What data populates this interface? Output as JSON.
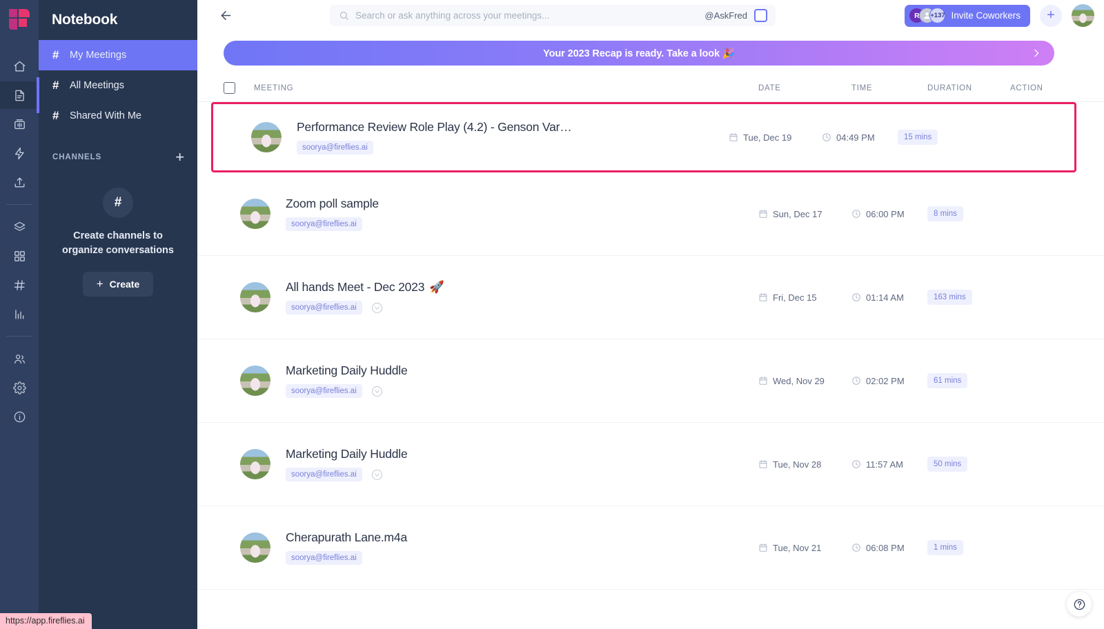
{
  "brand": {
    "logo_name": "fireflies-logo",
    "accent": "#6e75f5",
    "highlight": "#ea1e63"
  },
  "rail": {
    "items": [
      {
        "name": "home-icon",
        "label": "Home"
      },
      {
        "name": "notebook-icon",
        "label": "Notebook"
      },
      {
        "name": "inbox-icon",
        "label": "Inbox"
      },
      {
        "name": "automation-icon",
        "label": "Automations"
      },
      {
        "name": "upload-icon",
        "label": "Upload"
      },
      {
        "name": "layers-icon",
        "label": "Topic Tracker"
      },
      {
        "name": "apps-icon",
        "label": "Apps"
      },
      {
        "name": "channels-icon",
        "label": "Channels"
      },
      {
        "name": "analytics-icon",
        "label": "Analytics"
      },
      {
        "name": "team-icon",
        "label": "Team"
      },
      {
        "name": "gear-icon",
        "label": "Settings"
      },
      {
        "name": "info-icon",
        "label": "Help"
      }
    ]
  },
  "sidebar": {
    "title": "Notebook",
    "nav": [
      {
        "label": "My Meetings",
        "active": true
      },
      {
        "label": "All Meetings",
        "active": false
      },
      {
        "label": "Shared With Me",
        "active": false
      }
    ],
    "channels": {
      "header": "CHANNELS",
      "add_label": "+",
      "empty_glyph": "#",
      "empty_text": "Create channels to organize conversations",
      "create_label": "Create",
      "create_plus": "+"
    }
  },
  "header": {
    "back_label": "Back",
    "search": {
      "placeholder": "Search or ask anything across your meetings...",
      "value": ""
    },
    "askfred_label": "@AskFred",
    "invite": {
      "label": "Invite Coworkers",
      "avatars": [
        {
          "initial": "R",
          "kind": "letter"
        },
        {
          "initial": "",
          "kind": "photo"
        },
        {
          "initial": "+137",
          "kind": "count"
        }
      ]
    },
    "add_label": "+",
    "avatar_name": "user-avatar"
  },
  "banner": {
    "text": "Your 2023 Recap is ready. Take a look 🎉",
    "chevron": "›"
  },
  "table": {
    "columns": {
      "meeting": "MEETING",
      "date": "DATE",
      "time": "TIME",
      "duration": "DURATION",
      "action": "ACTION"
    },
    "rows": [
      {
        "title": "Performance Review Role Play (4.2) - Genson Var…",
        "email": "soorya@fireflies.ai",
        "date": "Tue, Dec 19",
        "time": "04:49 PM",
        "duration": "15 mins",
        "source_icon": false,
        "emoji": "",
        "selected": true
      },
      {
        "title": "Zoom poll sample",
        "email": "soorya@fireflies.ai",
        "date": "Sun, Dec 17",
        "time": "06:00 PM",
        "duration": "8 mins",
        "source_icon": false,
        "emoji": "",
        "selected": false
      },
      {
        "title": "All hands Meet - Dec 2023",
        "email": "soorya@fireflies.ai",
        "date": "Fri, Dec 15",
        "time": "01:14 AM",
        "duration": "163 mins",
        "source_icon": true,
        "emoji": "🚀",
        "selected": false
      },
      {
        "title": "Marketing Daily Huddle",
        "email": "soorya@fireflies.ai",
        "date": "Wed, Nov 29",
        "time": "02:02 PM",
        "duration": "61 mins",
        "source_icon": true,
        "emoji": "",
        "selected": false
      },
      {
        "title": "Marketing Daily Huddle",
        "email": "soorya@fireflies.ai",
        "date": "Tue, Nov 28",
        "time": "11:57 AM",
        "duration": "50 mins",
        "source_icon": true,
        "emoji": "",
        "selected": false
      },
      {
        "title": "Cherapurath Lane.m4a",
        "email": "soorya@fireflies.ai",
        "date": "Tue, Nov 21",
        "time": "06:08 PM",
        "duration": "1 mins",
        "source_icon": false,
        "emoji": "",
        "selected": false
      }
    ]
  },
  "statusbar": {
    "url": "https://app.fireflies.ai"
  },
  "help": {
    "glyph": "?"
  }
}
